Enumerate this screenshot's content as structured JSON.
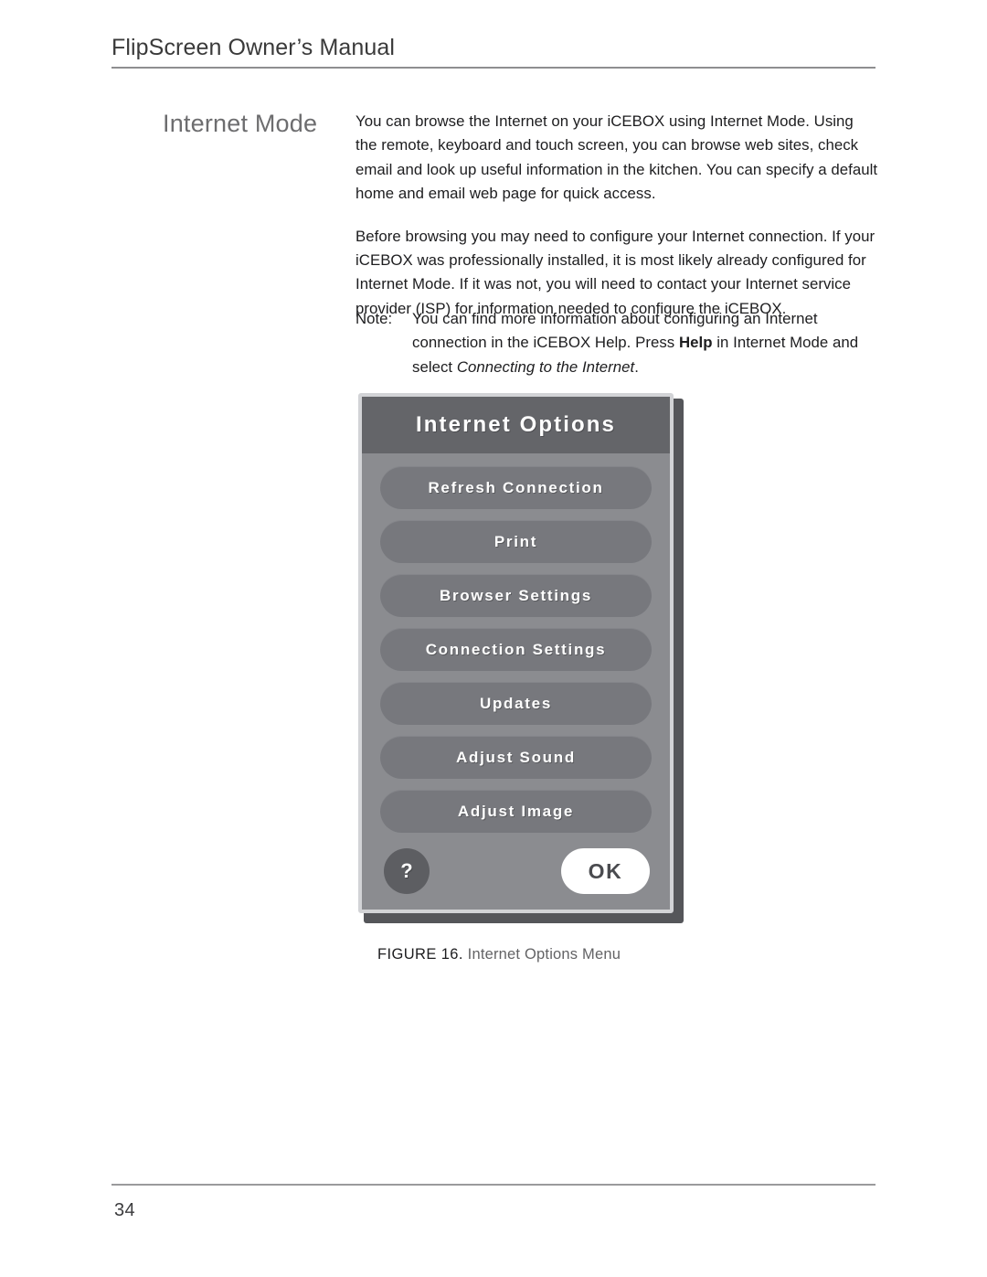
{
  "header": {
    "running_title": "FlipScreen Owner’s Manual"
  },
  "section": {
    "title": "Internet Mode"
  },
  "body": {
    "paragraphs": [
      "You can browse the Internet on your iCEBOX using Internet Mode. Using the remote, keyboard and touch screen, you can browse web sites, check email and look up useful information in the kitchen. You can specify a default home and email web page for quick access.",
      "Before browsing you may need to configure your Internet connection. If your iCEBOX was professionally installed, it is most likely already configured for Internet Mode. If it was not, you will need to contact your Internet service provider (ISP) for information needed to configure the iCEBOX."
    ]
  },
  "note": {
    "label": "Note:",
    "text_part1": "You can find more information about configuring an Internet connection in the iCEBOX Help. Press ",
    "bold_term": "Help",
    "text_part2": " in Internet Mode and select ",
    "italic_term": "Connecting to the Internet",
    "text_part3": "."
  },
  "dialog": {
    "title": "Internet Options",
    "buttons": [
      {
        "label": "Refresh Connection"
      },
      {
        "label": "Print"
      },
      {
        "label": "Browser Settings"
      },
      {
        "label": "Connection Settings"
      },
      {
        "label": "Updates"
      },
      {
        "label": "Adjust Sound"
      },
      {
        "label": "Adjust Image"
      }
    ],
    "help_label": "?",
    "ok_label": "OK",
    "colors": {
      "dialog_background": "#8b8c90",
      "header_band": "#646569",
      "button_fill": "#77787d",
      "button_text": "#ffffff",
      "help_fill": "#5d5e62",
      "ok_fill": "#ffffff",
      "ok_text": "#4a4b4f",
      "bezel": "#d2d3d6",
      "shadow": "#55565a"
    }
  },
  "figure": {
    "number": "FIGURE 16.",
    "caption": "Internet Options Menu"
  },
  "footer": {
    "page_number": "34"
  }
}
